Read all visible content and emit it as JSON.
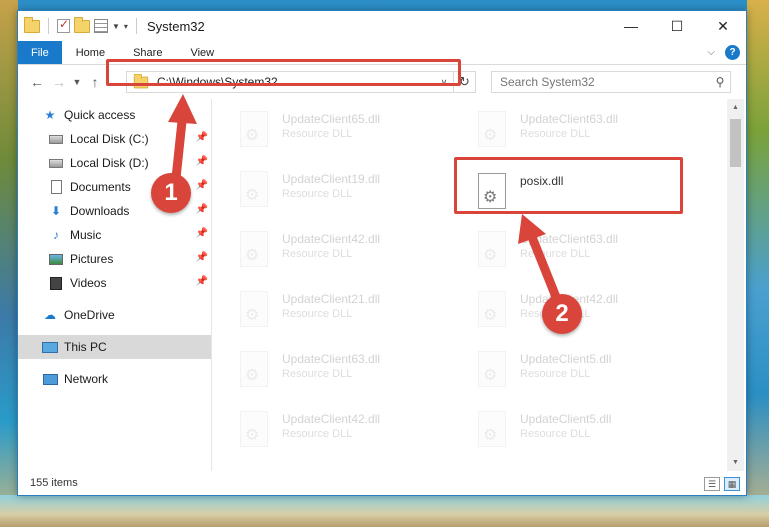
{
  "window": {
    "title": "System32",
    "controls": {
      "minimize": "—",
      "maximize": "☐",
      "close": "✕"
    }
  },
  "ribbon": {
    "tabs": [
      "File",
      "Home",
      "Share",
      "View"
    ]
  },
  "address": {
    "path": "C:\\Windows\\System32",
    "search_placeholder": "Search System32"
  },
  "nav": {
    "quick_access": "Quick access",
    "items": [
      {
        "label": "Local Disk (C:)",
        "icon": "drive-icon",
        "pinned": true
      },
      {
        "label": "Local Disk (D:)",
        "icon": "drive-icon",
        "pinned": true
      },
      {
        "label": "Documents",
        "icon": "document-icon",
        "pinned": true
      },
      {
        "label": "Downloads",
        "icon": "download-icon",
        "pinned": true
      },
      {
        "label": "Music",
        "icon": "music-icon",
        "pinned": true
      },
      {
        "label": "Pictures",
        "icon": "pictures-icon",
        "pinned": true
      },
      {
        "label": "Videos",
        "icon": "video-icon",
        "pinned": true
      }
    ],
    "onedrive": "OneDrive",
    "this_pc": "This PC",
    "network": "Network"
  },
  "files": {
    "col1": [
      {
        "name": "UpdateClient65.dll",
        "type": "Resource DLL"
      },
      {
        "name": "UpdateClient19.dll",
        "type": "Resource DLL"
      },
      {
        "name": "UpdateClient42.dll",
        "type": "Resource DLL"
      },
      {
        "name": "UpdateClient21.dll",
        "type": "Resource DLL"
      },
      {
        "name": "UpdateClient63.dll",
        "type": "Resource DLL"
      },
      {
        "name": "UpdateClient42.dll",
        "type": "Resource DLL"
      }
    ],
    "col2": [
      {
        "name": "UpdateClient63.dll",
        "type": "Resource DLL"
      },
      {
        "name": "posix.dll",
        "type": ""
      },
      {
        "name": "UpdateClient63.dll",
        "type": "Resource DLL"
      },
      {
        "name": "UpdateClient42.dll",
        "type": "Resource DLL"
      },
      {
        "name": "UpdateClient5.dll",
        "type": "Resource DLL"
      },
      {
        "name": "UpdateClient5.dll",
        "type": "Resource DLL"
      }
    ]
  },
  "status": {
    "count": "155 items"
  },
  "annotations": {
    "step1": "1",
    "step2": "2",
    "color": "#d9443b"
  }
}
